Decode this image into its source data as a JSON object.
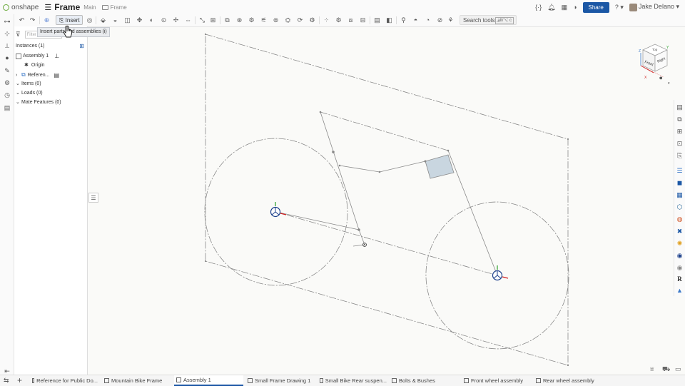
{
  "app": {
    "logo_text": "onshape",
    "document_title": "Frame",
    "branch": "Main",
    "breadcrumb": "Frame"
  },
  "topright": {
    "share_label": "Share",
    "help_label": "?",
    "user_name": "Jake Delano"
  },
  "toolbar": {
    "insert_label": "Insert",
    "search_tools_label": "Search tools...",
    "search_shortcut": "alt/⌥ c"
  },
  "tooltip": {
    "text": "Insert parts and assemblies (i)"
  },
  "panel": {
    "filter_placeholder": "Filter by name",
    "instances_header": "Instances (1)",
    "items": [
      {
        "label": "Assembly 1"
      },
      {
        "label": "Origin"
      },
      {
        "label": "Referen..."
      },
      {
        "label": "Items (0)"
      },
      {
        "label": "Loads (0)"
      },
      {
        "label": "Mate Features (0)"
      }
    ]
  },
  "viewcube": {
    "top_label": "Top",
    "front_label": "Front",
    "right_label": "Right",
    "x_label": "X",
    "y_label": "Y",
    "z_label": "Z"
  },
  "tabs": [
    {
      "label": "Reference for Public Do..."
    },
    {
      "label": "Mountain Bike Frame"
    },
    {
      "label": "Assembly 1"
    },
    {
      "label": "Small Frame Drawing 1"
    },
    {
      "label": "Small Bike Rear suspen..."
    },
    {
      "label": "Bolts & Bushes"
    },
    {
      "label": "Front wheel assembly"
    },
    {
      "label": "Rear wheel assembly"
    }
  ],
  "colors": {
    "accent": "#1b57a5",
    "sketch_line": "#8a8a8a",
    "highlight_face": "#c9d6e0"
  }
}
